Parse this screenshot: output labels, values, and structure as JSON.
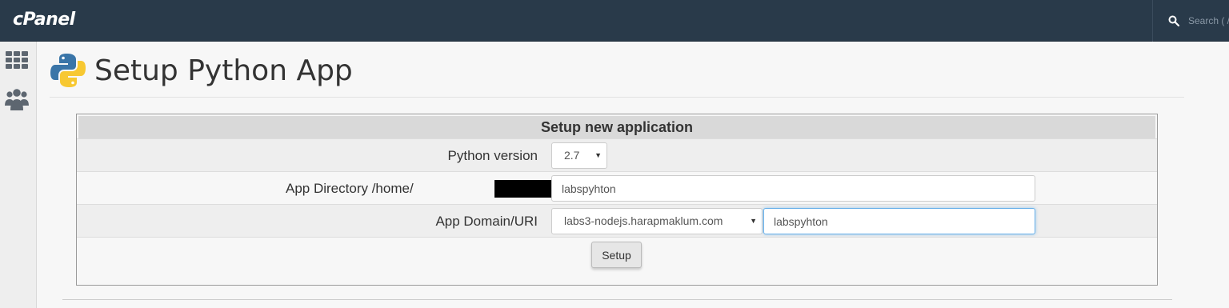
{
  "header": {
    "logo_text": "cPanel",
    "search": {
      "placeholder": "Search ( /",
      "value": ""
    },
    "colors": {
      "topbar": "#293a4a",
      "focus": "#66afe9"
    }
  },
  "sidebar": {
    "items": [
      {
        "icon": "grid-icon"
      },
      {
        "icon": "users-icon"
      }
    ]
  },
  "page": {
    "title": "Setup Python App",
    "icon": "python-logo-icon"
  },
  "form": {
    "heading": "Setup new application",
    "python_version": {
      "label": "Python version",
      "selected": "2.7"
    },
    "app_directory": {
      "label": "App Directory /home/",
      "value": "labspyhton"
    },
    "app_domain": {
      "label": "App Domain/URI",
      "selected": "labs3-nodejs.harapmaklum.com",
      "uri_value": "labspyhton"
    },
    "setup_label": "Setup"
  }
}
